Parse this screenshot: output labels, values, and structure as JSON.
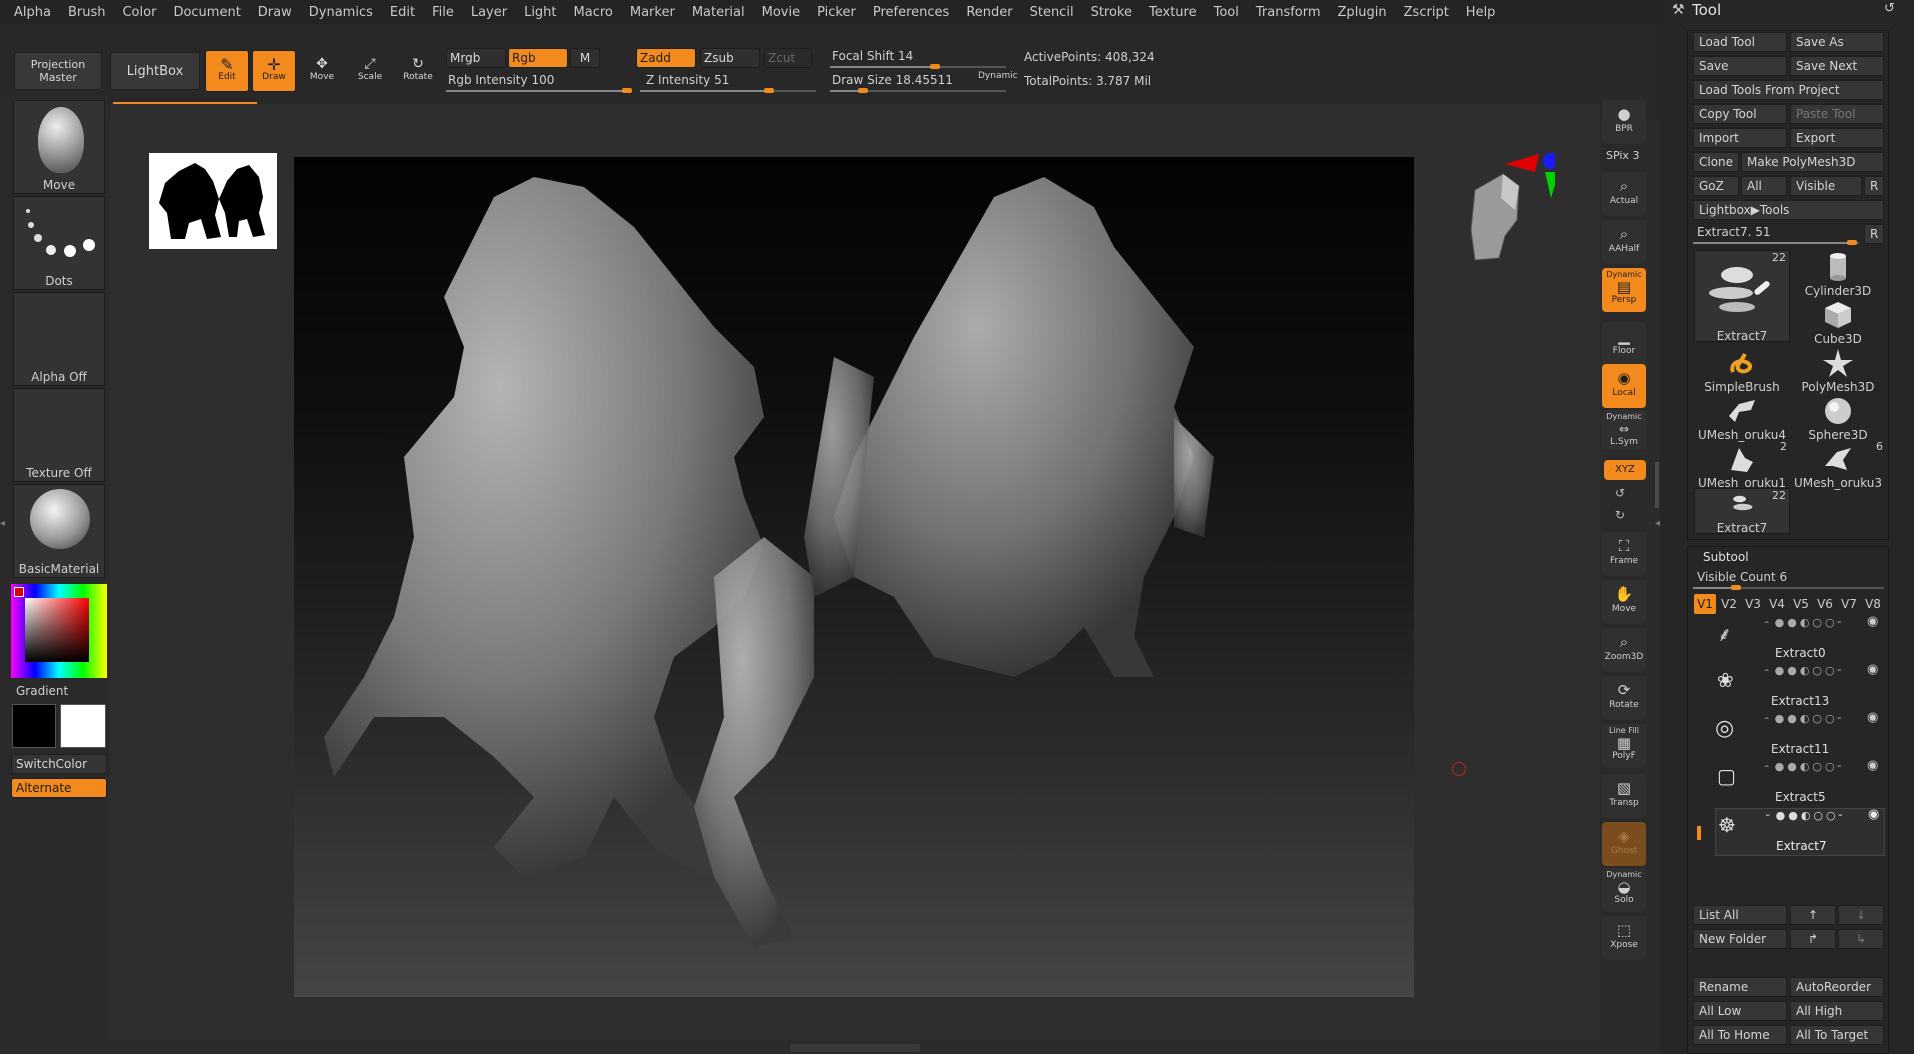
{
  "menu": [
    "Alpha",
    "Brush",
    "Color",
    "Document",
    "Draw",
    "Dynamics",
    "Edit",
    "File",
    "Layer",
    "Light",
    "Macro",
    "Marker",
    "Material",
    "Movie",
    "Picker",
    "Preferences",
    "Render",
    "Stencil",
    "Stroke",
    "Texture",
    "Tool",
    "Transform",
    "Zplugin",
    "Zscript",
    "Help"
  ],
  "toolbar": {
    "projection_master": "Projection Master",
    "lightbox": "LightBox",
    "edit": "Edit",
    "draw": "Draw",
    "move": "Move",
    "scale": "Scale",
    "rotate": "Rotate",
    "mrgb": "Mrgb",
    "rgb": "Rgb",
    "m": "M",
    "rgb_intensity_label": "Rgb Intensity",
    "rgb_intensity": "100",
    "zadd": "Zadd",
    "zsub": "Zsub",
    "zcut": "Zcut",
    "z_intensity_label": "Z Intensity",
    "z_intensity": "51",
    "focal_shift_label": "Focal Shift",
    "focal_shift": "14",
    "draw_size_label": "Draw Size",
    "draw_size": "18.45511",
    "dynamic": "Dynamic",
    "active_points_label": "ActivePoints:",
    "active_points": "408,324",
    "total_points_label": "TotalPoints:",
    "total_points": "3.787 Mil"
  },
  "left_shelf": {
    "brush": "Move",
    "stroke": "Dots",
    "alpha": "Alpha Off",
    "texture": "Texture Off",
    "material": "BasicMaterial",
    "gradient": "Gradient",
    "switch_color": "SwitchColor",
    "alternate": "Alternate"
  },
  "right_shelf": {
    "bpr": "BPR",
    "spix_label": "SPix",
    "spix": "3",
    "actual": "Actual",
    "aahalf": "AAHalf",
    "dynamic_top": "Dynamic",
    "persp": "Persp",
    "floor": "Floor",
    "local": "Local",
    "dynamic_mid": "Dynamic",
    "lsym": "L.Sym",
    "xyz": "XYZ",
    "frame": "Frame",
    "move": "Move",
    "zoom3d": "Zoom3D",
    "rotate": "Rotate",
    "line_fill": "Line Fill",
    "polyf": "PolyF",
    "transp": "Transp",
    "ghost": "Ghost",
    "dynamic_bot": "Dynamic",
    "solo": "Solo",
    "xpose": "Xpose"
  },
  "tool_panel": {
    "title": "Tool",
    "load_tool": "Load Tool",
    "save_as": "Save As",
    "save": "Save",
    "save_next": "Save Next",
    "load_from_project": "Load Tools From Project",
    "copy_tool": "Copy Tool",
    "paste_tool": "Paste Tool",
    "import": "Import",
    "export": "Export",
    "clone": "Clone",
    "make_polymesh": "Make PolyMesh3D",
    "goz": "GoZ",
    "all": "All",
    "visible": "Visible",
    "r": "R",
    "lightbox_tools": "Lightbox▶Tools",
    "current_tool_label": "Extract7.",
    "current_tool_value": "51",
    "r2": "R",
    "tools": [
      {
        "name": "Extract7",
        "count": "22"
      },
      {
        "name": "Cylinder3D",
        "count": ""
      },
      {
        "name": "Cube3D",
        "count": ""
      },
      {
        "name": "SimpleBrush",
        "count": ""
      },
      {
        "name": "PolyMesh3D",
        "count": ""
      },
      {
        "name": "UMesh_oruku4",
        "count": ""
      },
      {
        "name": "Sphere3D",
        "count": ""
      },
      {
        "name": "UMesh_oruku1",
        "count": "2"
      },
      {
        "name": "UMesh_oruku3",
        "count": "6"
      },
      {
        "name": "Extract7",
        "count": "22"
      }
    ],
    "subtool_title": "Subtool",
    "visible_count_label": "Visible Count",
    "visible_count": "6",
    "versions": [
      "V1",
      "V2",
      "V3",
      "V4",
      "V5",
      "V6",
      "V7",
      "V8"
    ],
    "subtools": [
      "Extract0",
      "Extract13",
      "Extract11",
      "Extract5",
      "Extract7"
    ],
    "list_all": "List All",
    "new_folder": "New Folder",
    "rename": "Rename",
    "auto_reorder": "AutoReorder",
    "all_low": "All Low",
    "all_high": "All High",
    "all_to_home": "All To Home",
    "all_to_target": "All To Target"
  },
  "colors": {
    "accent": "#f28a1e",
    "bg": "#2b2b2b",
    "panel": "#262626"
  }
}
